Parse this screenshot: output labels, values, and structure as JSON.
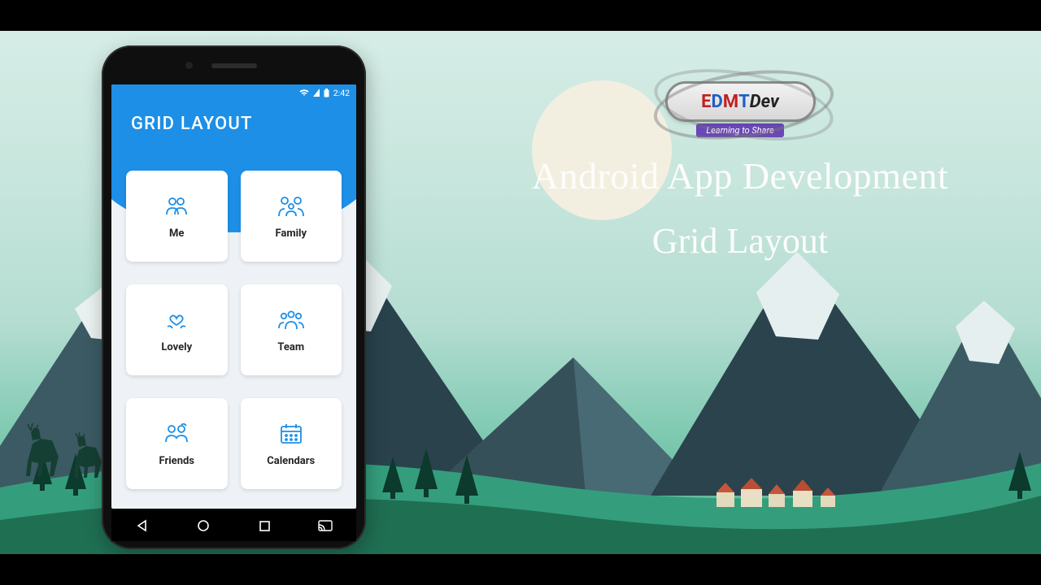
{
  "status": {
    "time": "2:42"
  },
  "header": {
    "title": "GRID LAYOUT"
  },
  "grid": {
    "items": [
      {
        "label": "Me",
        "icon": "person-icon"
      },
      {
        "label": "Family",
        "icon": "family-icon"
      },
      {
        "label": "Lovely",
        "icon": "heart-hands-icon"
      },
      {
        "label": "Team",
        "icon": "team-icon"
      },
      {
        "label": "Friends",
        "icon": "friends-icon"
      },
      {
        "label": "Calendars",
        "icon": "calendar-icon"
      }
    ]
  },
  "brand": {
    "name": "EDMTDev",
    "tagline": "Learning to Share"
  },
  "titles": {
    "line1": "Android App Development",
    "line2": "Grid Layout"
  },
  "colors": {
    "primary": "#1d8fe6",
    "card_bg": "#ffffff",
    "text_white": "#ffffff"
  }
}
